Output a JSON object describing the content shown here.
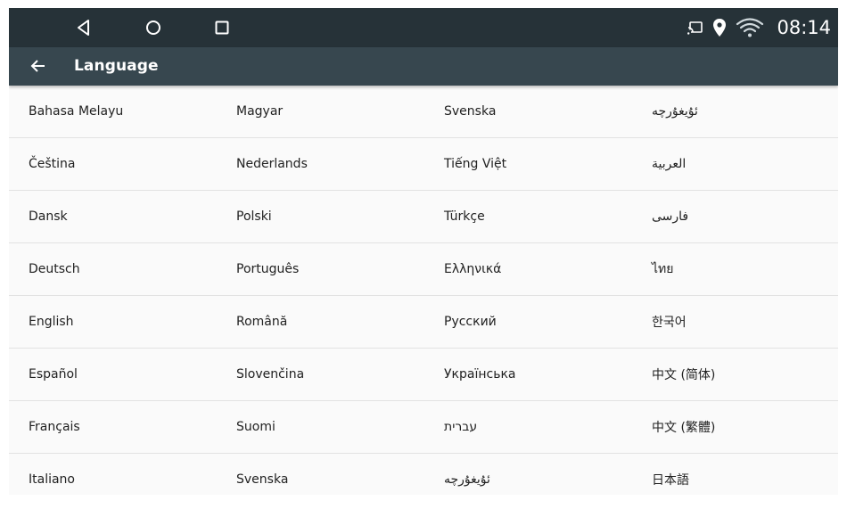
{
  "status_bar": {
    "nav": [
      "back-icon",
      "home-icon",
      "recents-icon"
    ],
    "icons": [
      "cast-icon",
      "location-icon",
      "wifi-icon"
    ],
    "time": "08:14"
  },
  "app_bar": {
    "back_icon": "arrow-left-icon",
    "title": "Language"
  },
  "colors": {
    "status_bar": "#263238",
    "app_bar": "#37474f",
    "list_background": "#fafafa",
    "divider": "#e2e2e2",
    "text": "#212121"
  },
  "languages": {
    "columns": [
      [
        "Bahasa Melayu",
        "Čeština",
        "Dansk",
        "Deutsch",
        "English",
        "Español",
        "Français",
        "Italiano"
      ],
      [
        "Magyar",
        "Nederlands",
        "Polski",
        "Português",
        "Română",
        "Slovenčina",
        "Suomi",
        "Svenska"
      ],
      [
        "Svenska",
        "Tiếng Việt",
        "Türkçe",
        "Ελληνικά",
        "Русский",
        "Українська",
        "עברית",
        "ئۇيغۇرچە"
      ],
      [
        "ئۇيغۇرچە",
        "العربية",
        "فارسی",
        "ไทย",
        "한국어",
        "中文 (简体)",
        "中文 (繁體)",
        "日本語"
      ]
    ]
  }
}
